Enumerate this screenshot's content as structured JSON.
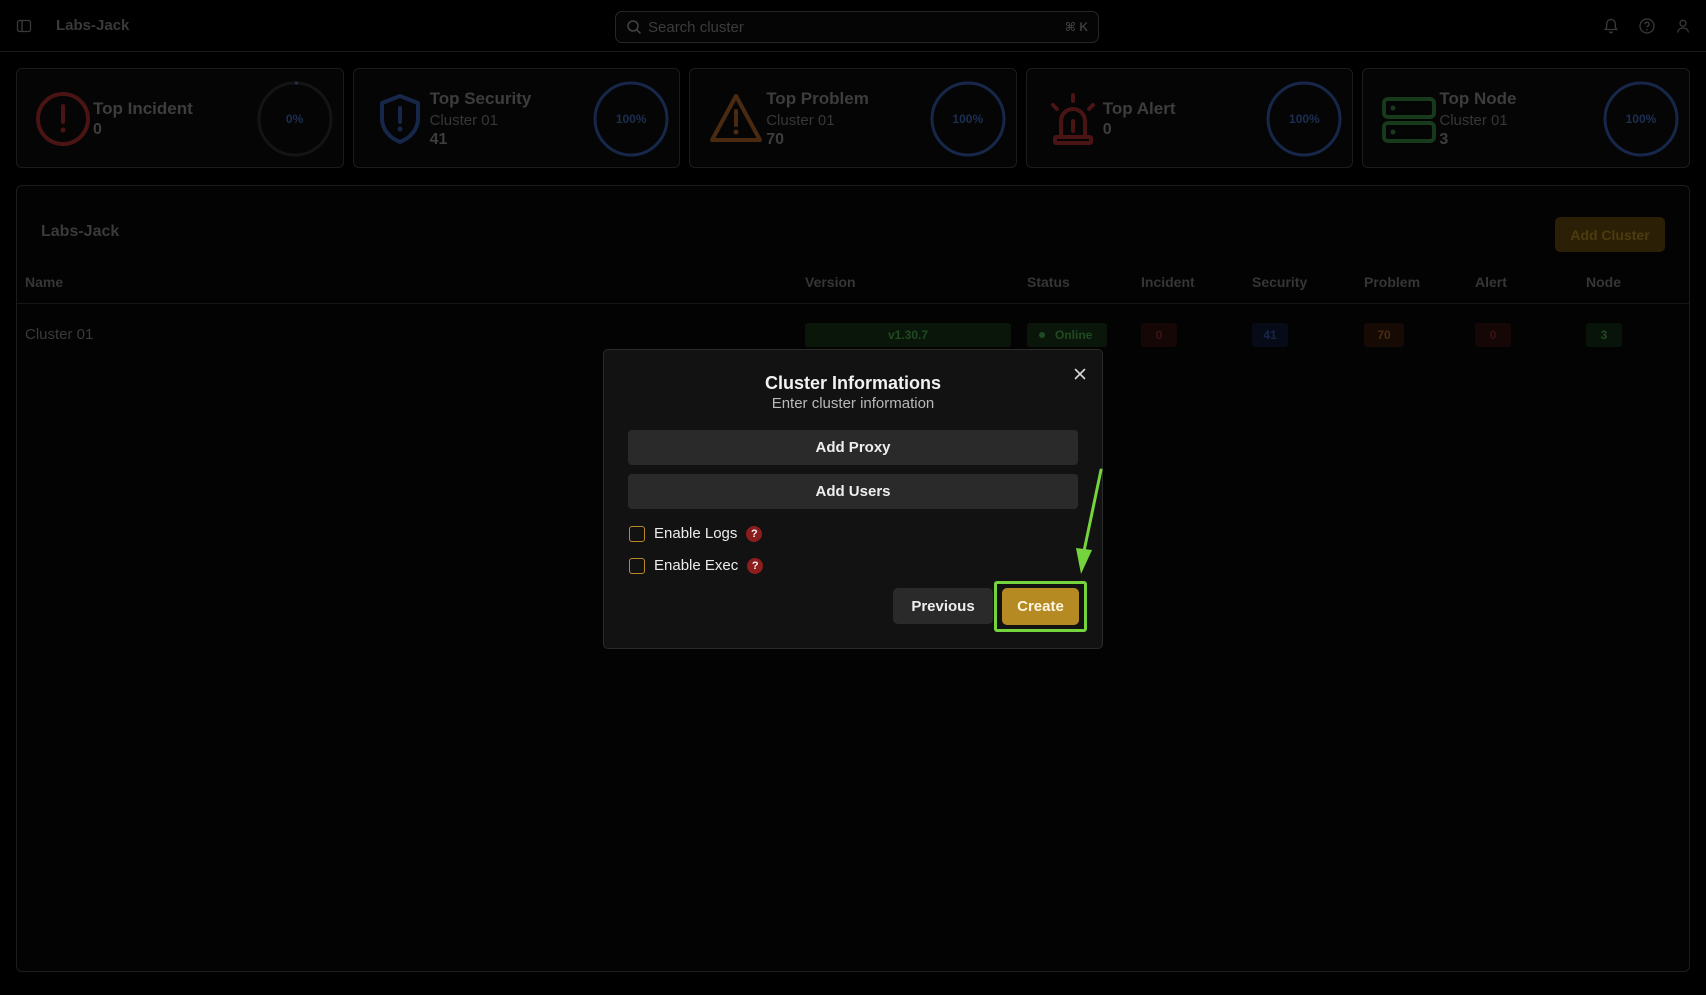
{
  "app": {
    "title": "Labs-Jack"
  },
  "search": {
    "placeholder": "Search cluster",
    "shortcut": "⌘ K"
  },
  "cards": [
    {
      "title": "Top Incident",
      "subtitle": "",
      "value": "0",
      "percent": "0%",
      "color": "#4a1414"
    },
    {
      "title": "Top Security",
      "subtitle": "Cluster 01",
      "value": "41",
      "percent": "100%",
      "color": "#17274a"
    },
    {
      "title": "Top Problem",
      "subtitle": "Cluster 01",
      "value": "70",
      "percent": "100%",
      "color": "#4a2a10"
    },
    {
      "title": "Top Alert",
      "subtitle": "",
      "value": "0",
      "percent": "100%",
      "color": "#4a1414"
    },
    {
      "title": "Top Node",
      "subtitle": "Cluster 01",
      "value": "3",
      "percent": "100%",
      "color": "#173a1c"
    }
  ],
  "panel": {
    "title": "Labs-Jack",
    "add_button": "Add Cluster",
    "columns": [
      "Name",
      "Version",
      "Status",
      "Incident",
      "Security",
      "Problem",
      "Alert",
      "Node"
    ],
    "rows": [
      {
        "name": "Cluster 01",
        "version": "v1.30.7",
        "status": "Online",
        "incident": "0",
        "security": "41",
        "problem": "70",
        "alert": "0",
        "node": "3"
      }
    ]
  },
  "modal": {
    "title": "Cluster Informations",
    "subtitle": "Enter cluster information",
    "add_proxy": "Add Proxy",
    "add_users": "Add Users",
    "enable_logs": "Enable Logs",
    "enable_exec": "Enable Exec",
    "help": "?",
    "previous": "Previous",
    "create": "Create"
  },
  "colors": {
    "accent": "#b58a22",
    "highlight": "#75d43d",
    "danger": "#8c1d1d"
  }
}
